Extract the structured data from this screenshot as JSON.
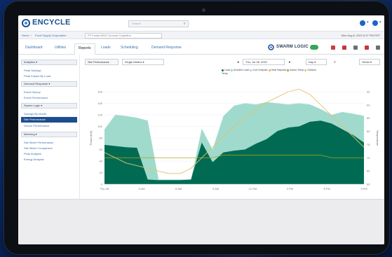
{
  "app": {
    "brand": "ENCYCLE",
    "search_placeholder": "Search",
    "header_icons": [
      "notifications-icon",
      "user-icon"
    ]
  },
  "breadcrumb": {
    "home": "Home",
    "site": "Food Supply Corporation",
    "selector": "FF Foods 6910 Concord Cupertino",
    "date": "Mon Aug 8, 2022 6:27 PM PDT"
  },
  "tabs": [
    {
      "label": "Dashboard",
      "active": false
    },
    {
      "label": "Utilities",
      "active": false
    },
    {
      "label": "Reports",
      "active": true
    },
    {
      "label": "Loads",
      "active": false
    },
    {
      "label": "Scheduling",
      "active": false
    },
    {
      "label": "Demand Response",
      "active": false
    }
  ],
  "brand_right": {
    "label": "SWARM LOGIC"
  },
  "toolbar_icons": [
    "alert-icon",
    "download-icon",
    "list-icon",
    "share-icon",
    "edit-icon"
  ],
  "sidebar": {
    "sections": [
      {
        "title": "Analytics ▾",
        "items": [
          "Peak Savings",
          "Peak Impact By Load"
        ]
      },
      {
        "title": "Demand Response ▾",
        "items": [
          "Event History",
          "Event Performance"
        ]
      },
      {
        "title": "Swarm Logic ▾",
        "items": [
          "Savings By Month",
          "Site Performance",
          "Device Performance"
        ],
        "active": "Site Performance"
      },
      {
        "title": "Metering ▾",
        "items": [
          "Site Meter Performance",
          "Site Meter Comparison",
          "Peak Analysis",
          "Energy Analysis"
        ]
      }
    ]
  },
  "controls": {
    "report": "Site Performance",
    "building": "Single Meters ▾",
    "date": "Thu, Jul 28, 2022",
    "range": "Day ▾",
    "interval": "15min ▾"
  },
  "legend": [
    "Load",
    "Avoided Load",
    "Cool Setpoint",
    "Heat Setpoint",
    "Indoor Temp",
    "Outdoor Temp"
  ],
  "colors": {
    "load": "#006b52",
    "avoided": "#8fd3c4",
    "cool_setpoint": "#a8d4f0",
    "heat_setpoint": "#e6b84a",
    "indoor_temp": "#b0a21a",
    "outdoor_temp": "#e2c26a",
    "brand": "#1c4e8f"
  },
  "chart_data": {
    "type": "area",
    "x_ticks": [
      "Thu 28",
      "3 AM",
      "6 AM",
      "9 AM",
      "12 PM",
      "3 PM",
      "6 PM",
      "9 PM"
    ],
    "y_left_ticks": [
      0,
      20,
      40,
      60,
      80,
      100,
      120,
      140,
      160
    ],
    "y_left_label": "Power (kW)",
    "y_right_ticks": [
      60,
      65,
      70,
      75,
      80,
      85,
      90,
      95
    ],
    "y_right_label": "Temperature",
    "ylim": [
      0,
      160
    ],
    "x": [
      0,
      1,
      2,
      3,
      4,
      5,
      6,
      7,
      8,
      9,
      10,
      11,
      12,
      13,
      14,
      15,
      16,
      17,
      18,
      19,
      20,
      21,
      22,
      23,
      24
    ],
    "series": [
      {
        "name": "Load",
        "values": [
          68,
          66,
          64,
          63,
          8,
          7,
          7,
          7,
          8,
          72,
          38,
          55,
          58,
          60,
          70,
          78,
          92,
          98,
          100,
          108,
          110,
          105,
          95,
          85,
          72
        ]
      },
      {
        "name": "Avoided Load",
        "values": [
          95,
          120,
          118,
          115,
          110,
          8,
          8,
          8,
          8,
          96,
          60,
          118,
          136,
          140,
          138,
          142,
          140,
          138,
          140,
          138,
          130,
          120,
          125,
          122,
          118
        ]
      },
      {
        "name": "Outdoor Temp",
        "values": [
          72,
          70,
          68,
          67,
          66,
          65,
          64,
          64,
          66,
          70,
          74,
          78,
          82,
          85,
          88,
          91,
          93,
          95,
          96,
          94,
          90,
          86,
          82,
          78,
          74
        ]
      },
      {
        "name": "Indoor Temp",
        "values": [
          70,
          70,
          70,
          70,
          70,
          70,
          70,
          70,
          70,
          70,
          70,
          71,
          71,
          71,
          71,
          71,
          71,
          71,
          71,
          71,
          71,
          70,
          70,
          70,
          70
        ]
      }
    ]
  }
}
